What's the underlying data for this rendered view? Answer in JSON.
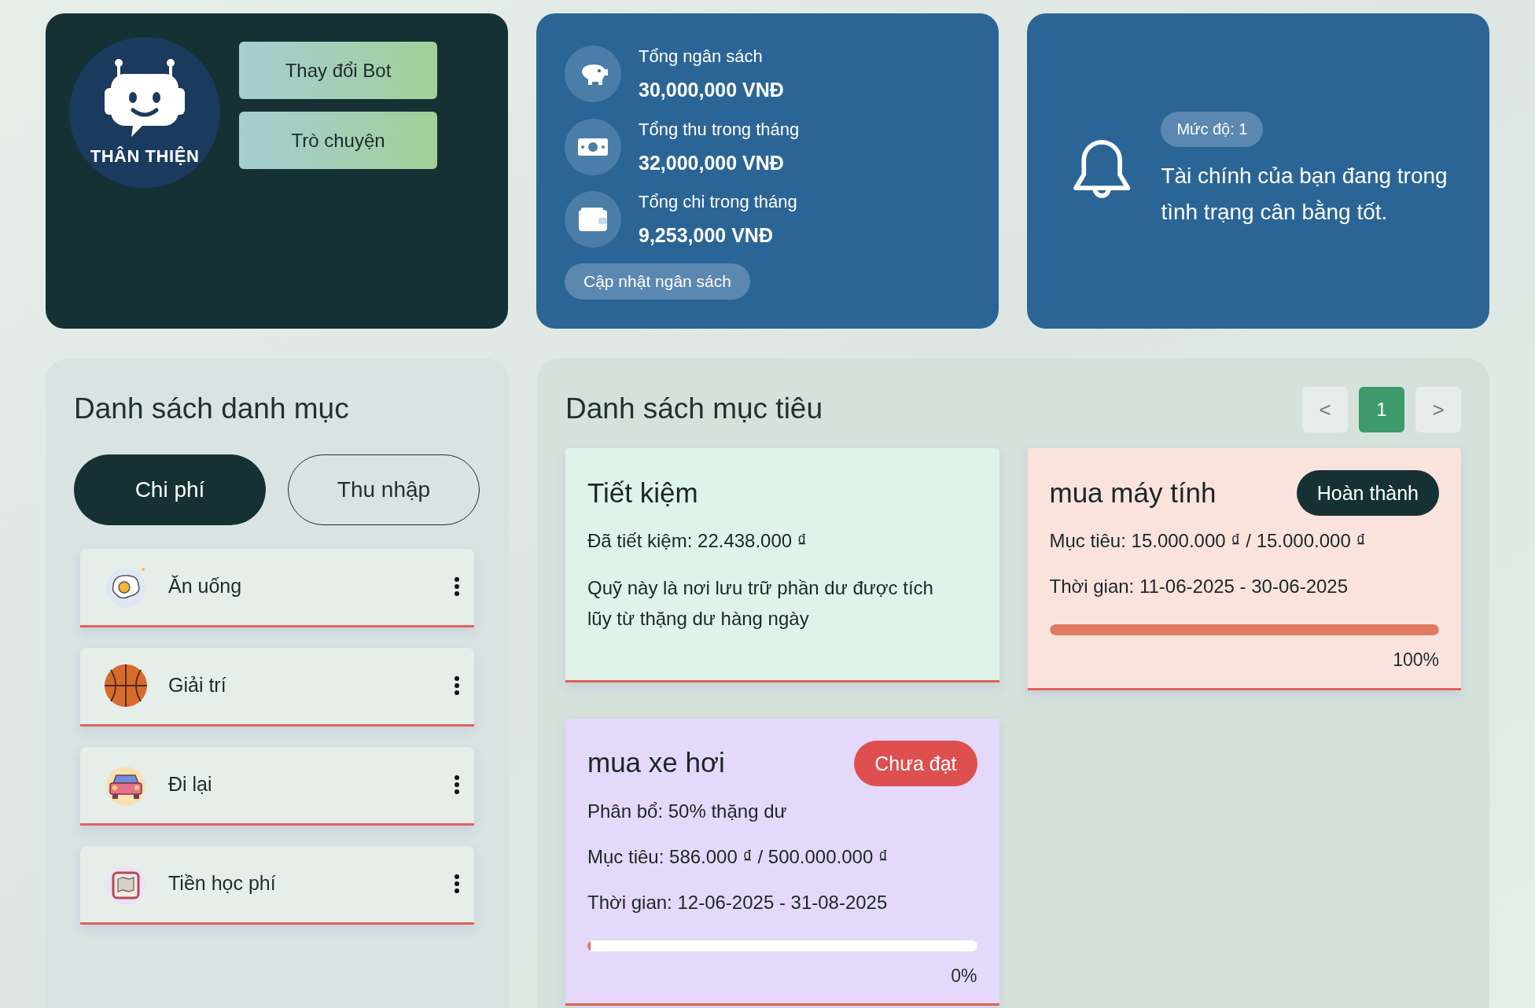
{
  "bot": {
    "label": "THÂN THIỆN",
    "buttons": [
      "Thay đổi Bot",
      "Trò chuyện"
    ]
  },
  "budget": {
    "items": [
      {
        "label": "Tổng ngân sách",
        "value": "30,000,000 VNĐ"
      },
      {
        "label": "Tổng thu trong tháng",
        "value": "32,000,000 VNĐ"
      },
      {
        "label": "Tổng chi trong tháng",
        "value": "9,253,000 VNĐ"
      }
    ],
    "button": "Cập nhật ngân sách"
  },
  "alert": {
    "badge": "Mức độ: 1",
    "message": "Tài chính của bạn đang trong tình trạng cân bằng tốt."
  },
  "categories": {
    "title": "Danh sách danh mục",
    "tabs": [
      {
        "label": "Chi phí",
        "selected": true
      },
      {
        "label": "Thu nhập",
        "selected": false
      }
    ],
    "items": [
      {
        "name": "Ăn uống"
      },
      {
        "name": "Giải trí"
      },
      {
        "name": "Đi lại"
      },
      {
        "name": "Tiền học phí"
      }
    ]
  },
  "goals": {
    "title": "Danh sách mục tiêu",
    "pagination": {
      "prev": "<",
      "pages": [
        {
          "label": "1",
          "selected": true
        }
      ],
      "next": ">"
    },
    "cards": [
      {
        "kind": "savings",
        "color": "#def4ea",
        "title": "Tiết kiệm",
        "lines": [
          "Đã tiết kiệm: 22.438.000 ₫"
        ],
        "description": "Quỹ này là nơi lưu trữ phần dư được tích lũy từ thặng dư hàng ngày"
      },
      {
        "kind": "goal",
        "color": "#fae3dd",
        "title": "mua máy tính",
        "status": {
          "kind": "done",
          "label": "Hoàn thành"
        },
        "lines": [
          "Mục tiêu: 15.000.000 ₫ / 15.000.000 ₫",
          "Thời gian: 11-06-2025 - 30-06-2025"
        ],
        "level": 1,
        "percent": "100%"
      },
      {
        "kind": "goal",
        "color": "#e4d9fa",
        "title": "mua xe hơi",
        "status": {
          "kind": "not_met",
          "label": "Chưa đạt"
        },
        "lines": [
          "Phân bổ: 50% thặng dư",
          "Mục tiêu: 586.000 ₫ / 500.000.000 ₫",
          "Thời gian: 12-06-2025 - 31-08-2025"
        ],
        "level": 0,
        "percent": "0%"
      }
    ]
  }
}
